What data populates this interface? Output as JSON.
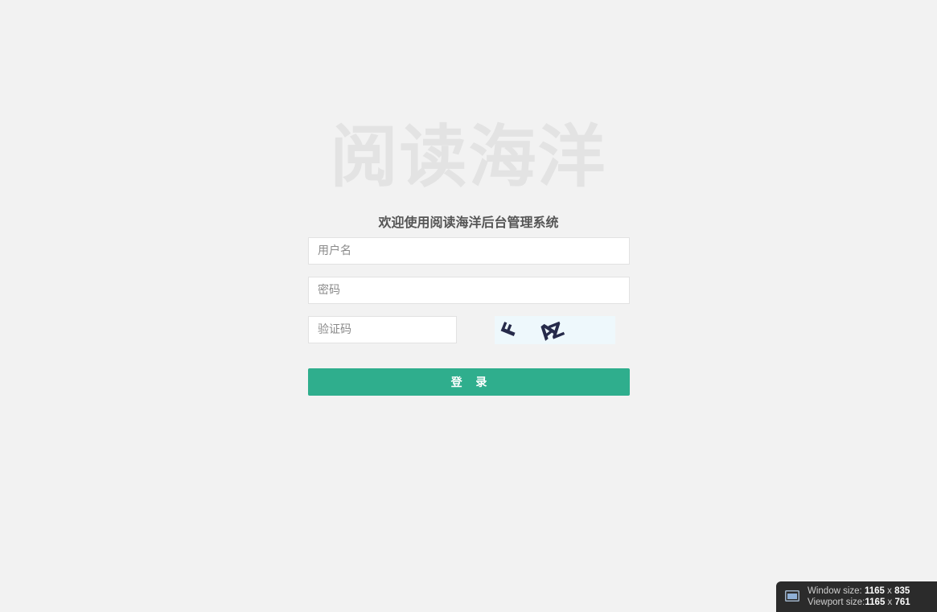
{
  "brand": {
    "title": "阅读海洋"
  },
  "login": {
    "welcome": "欢迎使用阅读海洋后台管理系统",
    "username_placeholder": "用户名",
    "password_placeholder": "密码",
    "captcha_placeholder": "验证码",
    "captcha_text": "FAZ",
    "submit_label": "登 录"
  },
  "size_overlay": {
    "window_label": "Window size:",
    "window_w": "1165",
    "window_h": "835",
    "viewport_label": "Viewport size:",
    "viewport_w": "1165",
    "viewport_h": "761",
    "separator": "x"
  },
  "colors": {
    "background": "#f2f2f2",
    "primary": "#2fae8d",
    "captcha_bg": "#eef8fc",
    "captcha_ink": "#262a4a"
  }
}
